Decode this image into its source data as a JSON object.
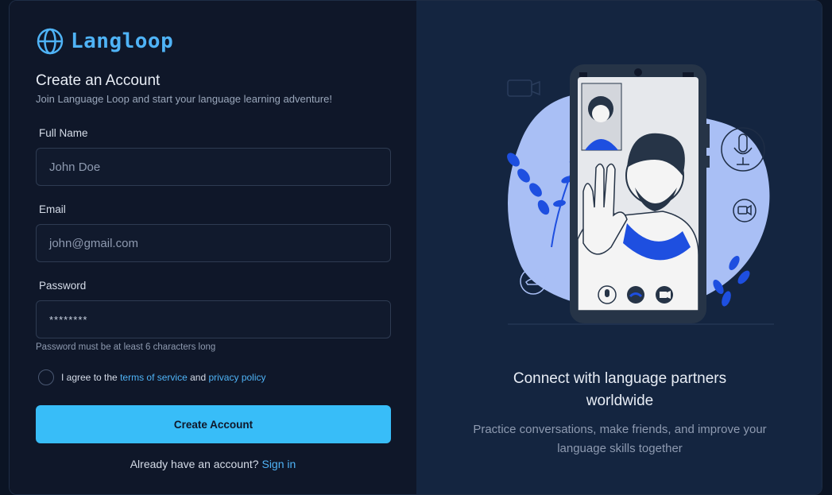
{
  "brand": {
    "name": "Langloop",
    "icon": "globe-icon",
    "color": "#4fb3f6"
  },
  "form": {
    "title": "Create an Account",
    "subtitle": "Join Language Loop and start your language learning adventure!",
    "full_name": {
      "label": "Full Name",
      "placeholder": "John Doe"
    },
    "email": {
      "label": "Email",
      "placeholder": "john@gmail.com"
    },
    "password": {
      "label": "Password",
      "value": "********",
      "hint": "Password must be at least 6 characters long"
    },
    "agree": {
      "prefix": "I agree to the",
      "terms": "terms of service",
      "and": "and",
      "privacy": "privacy policy"
    },
    "submit": "Create Account",
    "signin_prompt": "Already have an account?",
    "signin_link": "Sign in"
  },
  "promo": {
    "title": "Connect with language partners worldwide",
    "subtitle": "Practice conversations, make friends, and improve your language skills together"
  },
  "colors": {
    "accent": "#38bdf8",
    "panel_left": "#0f1729",
    "panel_right": "#142540",
    "illustration_blue": "#1e4fe0",
    "blob": "#a9bff5"
  }
}
